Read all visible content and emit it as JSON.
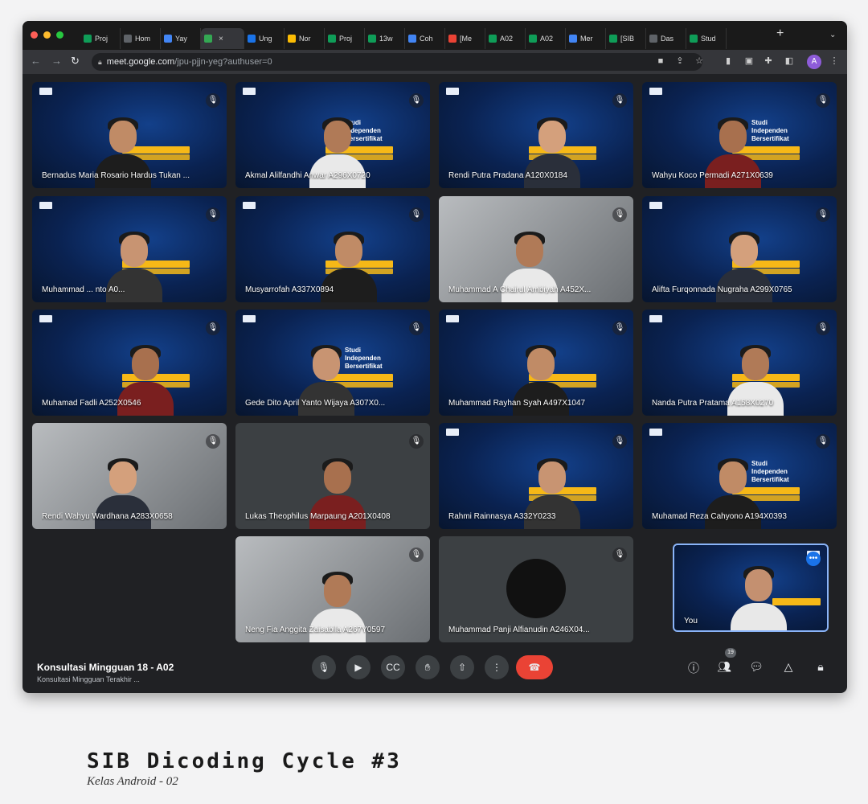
{
  "browser": {
    "tabs": [
      {
        "label": "Proj",
        "color": "#0f9d58"
      },
      {
        "label": "Hom",
        "color": "#5f6368"
      },
      {
        "label": "Yay",
        "color": "#4285f4"
      },
      {
        "label": "",
        "color": "#34a853",
        "active": true
      },
      {
        "label": "Ung",
        "color": "#1a73e8"
      },
      {
        "label": "Nor",
        "color": "#fbbc04"
      },
      {
        "label": "Proj",
        "color": "#0f9d58"
      },
      {
        "label": "13w",
        "color": "#0f9d58"
      },
      {
        "label": "Coh",
        "color": "#4285f4"
      },
      {
        "label": "[Me",
        "color": "#ea4335"
      },
      {
        "label": "A02",
        "color": "#0f9d58"
      },
      {
        "label": "A02",
        "color": "#0f9d58"
      },
      {
        "label": "Mer",
        "color": "#4285f4"
      },
      {
        "label": "[SIB",
        "color": "#0f9d58"
      },
      {
        "label": "Das",
        "color": "#5f6368"
      },
      {
        "label": "Stud",
        "color": "#0f9d58"
      }
    ],
    "new_tab": "+",
    "url_host": "meet.google.com",
    "url_path": "/jpu-pjjn-yeg?authuser=0",
    "profile_initial": "A"
  },
  "participants": [
    {
      "name": "Bernadus Maria Rosario Hardus Tukan ...",
      "style": "blue"
    },
    {
      "name": "Akmal Alilfandhi Anwar A296X0720",
      "style": "blue",
      "banner": "Studi Independen Bersertifikat"
    },
    {
      "name": "Rendi Putra Pradana A120X0184",
      "style": "blue"
    },
    {
      "name": "Wahyu Koco Permadi A271X0639",
      "style": "blue",
      "banner": "Studi Independen Bersertifikat"
    },
    {
      "name": "Muhammad ... nto A0...",
      "style": "blue"
    },
    {
      "name": "Musyarrofah A337X0894",
      "style": "blue"
    },
    {
      "name": "Muhammad A Chairul Ambiyah A452X...",
      "style": "cam-gray"
    },
    {
      "name": "Alifta Furqonnada Nugraha A299X0765",
      "style": "blue"
    },
    {
      "name": "Muhamad Fadli A252X0546",
      "style": "blue"
    },
    {
      "name": "Gede Dito April Yanto Wijaya A307X0...",
      "style": "blue",
      "banner": "Studi Independen Bersertifikat"
    },
    {
      "name": "Muhammad Rayhan Syah A497X1047",
      "style": "blue"
    },
    {
      "name": "Nanda Putra Pratama A158X0270",
      "style": "blue"
    },
    {
      "name": "Rendi Wahyu Wardhana A283X0658",
      "style": "cam-gray"
    },
    {
      "name": "Lukas Theophilus Marpaung A201X0408",
      "style": "gray"
    },
    {
      "name": "Rahmi Rainnasya A332Y0233",
      "style": "blue"
    },
    {
      "name": "Muhamad Reza Cahyono A194X0393",
      "style": "blue",
      "banner": "Studi Independen Bersertifikat"
    },
    {
      "name": "Neng Fia Anggita Zaisabila A267Y0597",
      "style": "cam-gray"
    },
    {
      "name": "Muhammad Panji Alfianudin A246X04...",
      "style": "gray"
    }
  ],
  "self_tile": {
    "name": "You"
  },
  "meeting": {
    "title": "Konsultasi Mingguan 18 - A02",
    "subtitle": "Konsultasi Mingguan Terakhir ..."
  },
  "participant_count": "19",
  "caption": {
    "title": "SIB Dicoding Cycle #3",
    "subtitle": "Kelas Android - 02"
  }
}
